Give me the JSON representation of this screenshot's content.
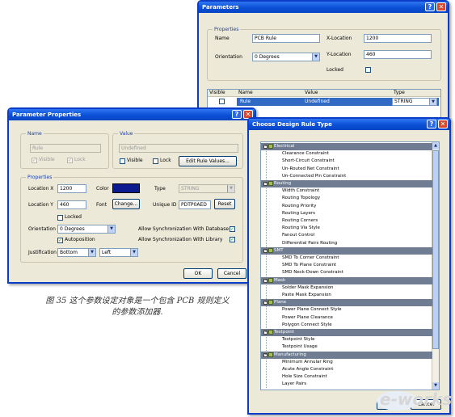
{
  "parameters_window": {
    "title": "Parameters",
    "properties_group": "Properties",
    "name_label": "Name",
    "name_value": "PCB Rule",
    "xloc_label": "X-Location",
    "xloc_value": "1200",
    "orientation_label": "Orientation",
    "orientation_value": "0 Degrees",
    "yloc_label": "Y-Location",
    "yloc_value": "460",
    "locked_label": "Locked",
    "table": {
      "headers": [
        "Visible",
        "Name",
        "Value",
        "Type"
      ],
      "row": {
        "name": "Rule",
        "value": "Undefined",
        "type": "STRING"
      }
    }
  },
  "param_props_window": {
    "title": "Parameter Properties",
    "name_group": "Name",
    "name_value": "Rule",
    "visible_label": "Visible",
    "lock_label": "Lock",
    "value_group": "Value",
    "value_value": "Undefined",
    "value_visible_label": "Visible",
    "value_lock_label": "Lock",
    "edit_rule_button": "Edit Rule Values...",
    "properties_group": "Properties",
    "location_x_label": "Location  X",
    "location_x_value": "1200",
    "color_label": "Color",
    "type_label": "Type",
    "type_value": "STRING",
    "location_y_label": "Location  Y",
    "location_y_value": "460",
    "font_label": "Font",
    "font_button": "Change...",
    "unique_id_label": "Unique ID",
    "unique_id_value": "PDTP0AED",
    "reset_button": "Reset",
    "locked_label": "Locked",
    "orientation_label": "Orientation",
    "orientation_value": "0 Degrees",
    "allow_sync_db_label": "Allow Synchronization With Database",
    "autoposition_label": "Autoposition",
    "allow_sync_lib_label": "Allow Synchronization With Library",
    "justification_label": "Justification",
    "justification_v": "Bottom",
    "justification_h": "Left",
    "ok_button": "OK",
    "cancel_button": "Cancel",
    "color_value": "#0b1a8f"
  },
  "choose_rule_window": {
    "title": "Choose Design Rule Type",
    "categories": [
      {
        "label": "Electrical",
        "items": [
          "Clearance Constraint",
          "Short-Circuit Constraint",
          "Un-Routed Net Constraint",
          "Un-Connected Pin Constraint"
        ]
      },
      {
        "label": "Routing",
        "items": [
          "Width Constraint",
          "Routing Topology",
          "Routing Priority",
          "Routing Layers",
          "Routing Corners",
          "Routing Via Style",
          "Fanout Control",
          "Differential Pairs Routing"
        ]
      },
      {
        "label": "SMT",
        "items": [
          "SMD To Corner Constraint",
          "SMD To Plane Constraint",
          "SMD Neck-Down Constraint"
        ]
      },
      {
        "label": "Mask",
        "items": [
          "Solder Mask Expansion",
          "Paste Mask Expansion"
        ]
      },
      {
        "label": "Plane",
        "items": [
          "Power Plane Connect Style",
          "Power Plane Clearance",
          "Polygon Connect Style"
        ]
      },
      {
        "label": "Testpoint",
        "items": [
          "Testpoint Style",
          "Testpoint Usage"
        ]
      },
      {
        "label": "Manufacturing",
        "items": [
          "Minimum Annular Ring",
          "Acute Angle Constraint",
          "Hole Size Constraint",
          "Layer Pairs"
        ]
      }
    ],
    "ok_button": "OK",
    "cancel_button": "Cancel"
  },
  "caption": {
    "line1": "图 35 这个参数设定对象是一个包含 PCB 规则定义",
    "line2": "的参数添加器."
  },
  "watermark": "e-works"
}
